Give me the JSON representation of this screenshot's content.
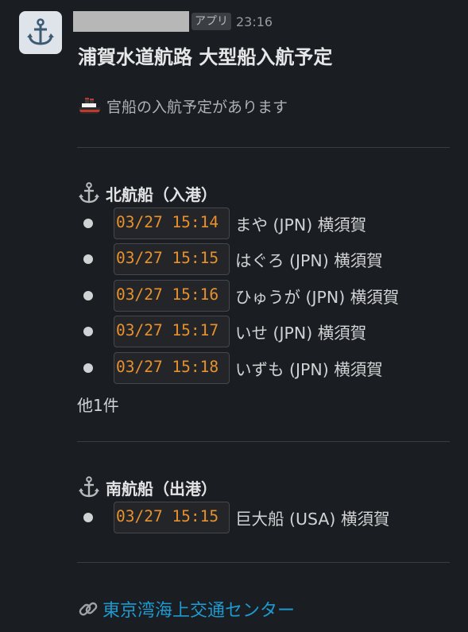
{
  "message": {
    "app_badge": "アプリ",
    "timestamp": "23:16",
    "title": "浦賀水道航路 大型船入航予定",
    "subtitle": "官船の入航予定があります"
  },
  "sections": [
    {
      "heading": "北航船（入港）",
      "items": [
        {
          "time": "03/27 15:14",
          "ship": "まや (JPN) 横須賀"
        },
        {
          "time": "03/27 15:15",
          "ship": "はぐろ (JPN) 横須賀"
        },
        {
          "time": "03/27 15:16",
          "ship": "ひゅうが (JPN) 横須賀"
        },
        {
          "time": "03/27 15:17",
          "ship": "いせ (JPN) 横須賀"
        },
        {
          "time": "03/27 15:18",
          "ship": "いずも (JPN) 横須賀"
        }
      ],
      "more": "他1件"
    },
    {
      "heading": "南航船（出港）",
      "items": [
        {
          "time": "03/27 15:15",
          "ship": "巨大船 (USA) 横須賀"
        }
      ]
    }
  ],
  "footer": {
    "link_text": "東京湾海上交通センター"
  },
  "icons": {
    "avatar": "anchor-icon",
    "subtitle": "ship-icon",
    "section": "anchor-icon",
    "link": "link-icon"
  },
  "colors": {
    "background": "#1a1d21",
    "code_text": "#e8912d",
    "link": "#1d9bd1"
  }
}
